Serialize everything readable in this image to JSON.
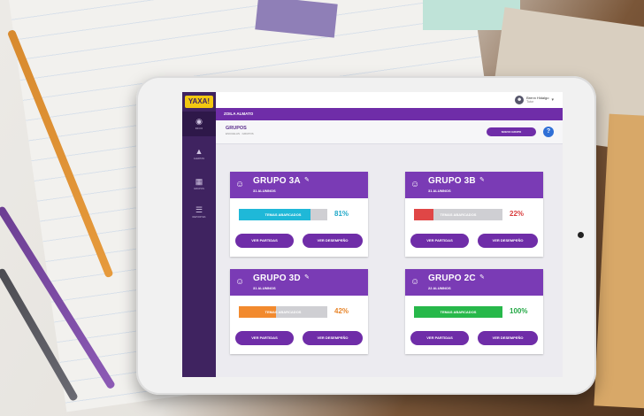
{
  "app": {
    "logo": "YAXA!"
  },
  "sidebar": {
    "items": [
      {
        "icon": "dashboard-icon",
        "label": "INICIO"
      },
      {
        "icon": "alert-icon",
        "label": "ALERTAS"
      },
      {
        "icon": "groups-icon",
        "label": "GRUPOS"
      },
      {
        "icon": "reports-icon",
        "label": "REPORTES"
      }
    ]
  },
  "topbar": {
    "user_name": "Brenn Hidalgo",
    "user_role": "Tutor"
  },
  "school": {
    "name": "ZOILA ALMATO"
  },
  "page": {
    "title": "GRUPOS",
    "breadcrumb": "ESCUELAS · GRUPOS",
    "new_group_label": "NUEVO GRUPO",
    "help_label": "?"
  },
  "groups": [
    {
      "name": "GRUPO 3A",
      "students": "31 ALUMNOS",
      "progress_label": "TEMAS ABARCADOS",
      "progress": 81,
      "percent_text": "81%",
      "color": "#1fb8d8",
      "pct_color": "#1fa8c8",
      "btn_matches": "VER PARTIDAS",
      "btn_performance": "VER DESEMPEÑO"
    },
    {
      "name": "GRUPO 3B",
      "students": "31 ALUMNOS",
      "progress_label": "TEMAS ABARCADOS",
      "progress": 22,
      "percent_text": "22%",
      "color": "#e04646",
      "pct_color": "#d93c3c",
      "btn_matches": "VER PARTIDAS",
      "btn_performance": "VER DESEMPEÑO"
    },
    {
      "name": "GRUPO 3D",
      "students": "31 ALUMNOS",
      "progress_label": "TEMAS ABARCADOS",
      "progress": 42,
      "percent_text": "42%",
      "color": "#f28a2e",
      "pct_color": "#e8852a",
      "btn_matches": "VER PARTIDAS",
      "btn_performance": "VER DESEMPEÑO"
    },
    {
      "name": "GRUPO 2C",
      "students": "22 ALUMNOS",
      "progress_label": "TEMAS ABARCADOS",
      "progress": 100,
      "percent_text": "100%",
      "color": "#27b84a",
      "pct_color": "#23a845",
      "btn_matches": "VER PARTIDAS",
      "btn_performance": "VER DESEMPEÑO"
    }
  ]
}
